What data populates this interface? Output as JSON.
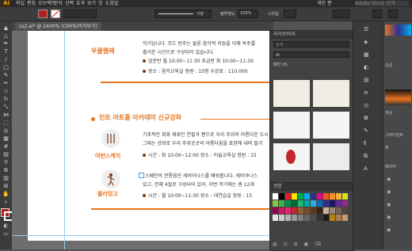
{
  "menubar": {
    "logo": "Ai",
    "items": [
      "파일",
      "편집",
      "오브젝트",
      "문자",
      "선택",
      "효과",
      "보기",
      "창",
      "도움말"
    ],
    "search_placeholder": "Adobe Stock 검색",
    "workspace": "개인 편"
  },
  "control_bar": {
    "stroke_style": "기본",
    "opacity_label": "불투명도",
    "opacity_value": "100%",
    "style_label": "스타일"
  },
  "document_tab": "cs2.ai* @ 2400% (CMYK/미리보기)",
  "artboard": {
    "section1": {
      "title": "우쿨렐레",
      "intro_line1": "악기입니다. 코드 반주는 물론 음악적 리듬을 이해 독주를",
      "intro_line2": "즐거운 시간으로 구성되어 있습니다.",
      "time_label": "입문반",
      "time_text": "월 10:00~11:30    초급반 화 10:00~11:30",
      "place_text": "장소 : 음악교육실    정원 : 15명    수강료 : 110,000"
    },
    "section_header": "민트 아트홀 아카데미 신규강좌",
    "course1": {
      "title": "어반스케치",
      "desc_line1": "기초적인 회화 재료인 연필과 펜으로 우리 주위의 아름다운 도시",
      "desc_line2": "그래는 강좌로 우리 주위곳곳의 아름다움을 표현해 내며 즐거",
      "schedule": "시간 : 화 10:00~12:00    장소 : 미술교육실    정원 : 15"
    },
    "course2": {
      "title": "플라밍고",
      "desc_line1": "스페인의 전통음인 세비야나스를 배워봅니다. 세비야나스",
      "desc_line2": "있고, 전체 4절로 구성되어 있어, 이번 학기에는 총 12개",
      "schedule": "시간 : 월 10:00~11:30    장소 : 대연습실    정원 : 15"
    }
  },
  "library_panel": {
    "title": "라이브러리",
    "search_placeholder": "검색",
    "dropdown": "AI",
    "section": "패턴 (8)",
    "more": "···"
  },
  "swatches_panel": {
    "title": "견본",
    "colors": [
      "#ffffff",
      "#000000",
      "#e31e24",
      "#f7e400",
      "#00a651",
      "#00aeef",
      "#2e3192",
      "#ec008c",
      "#f15a24",
      "#f7931e",
      "#fbb03b",
      "#d9e021",
      "#8cc63f",
      "#39b54a",
      "#009245",
      "#006837",
      "#22b573",
      "#00a99d",
      "#29abe2",
      "#0071bc",
      "#2e3192",
      "#1b1464",
      "#662d91",
      "#93278f",
      "#9e005d",
      "#d4145a",
      "#ed1e79",
      "#c1272d",
      "#8c6239",
      "#754c24",
      "#603813",
      "#42210b",
      "#c7b299",
      "#998675",
      "#736357",
      "#534741",
      "#e6e6e6",
      "#cccccc",
      "#b3b3b3",
      "#999999",
      "#808080",
      "#666666",
      "#4d4d4d",
      "#333333",
      "#1a1a1a",
      "#b8860b",
      "#a67c52",
      "#c69c6d"
    ]
  },
  "right_panels": {
    "items": [
      "속성",
      "레이어",
      "색상",
      "그라디언트",
      "획",
      "투명도",
      "레이어"
    ]
  },
  "colors": {
    "accent_orange": "#e8741f",
    "accent_brown": "#7a3a12",
    "guide": "#8fd0f0"
  }
}
